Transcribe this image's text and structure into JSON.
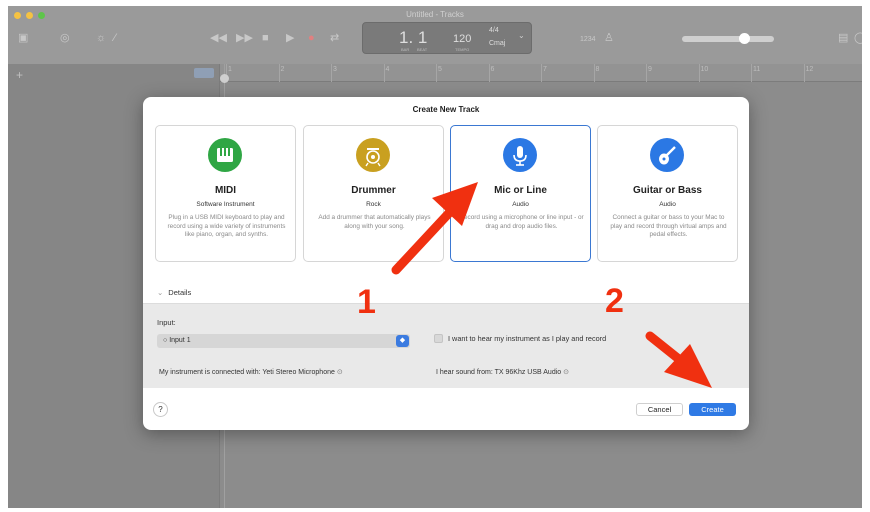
{
  "window": {
    "title": "Untitled - Tracks",
    "traffic_colors": [
      "#f5c242",
      "#f5c242",
      "#5ec54a"
    ]
  },
  "lcd": {
    "position": "1. 1",
    "position_sub_bar": "BAR",
    "position_sub_beat": "BEAT",
    "tempo": "120",
    "tempo_sub": "TEMPO",
    "time_signature": "4/4",
    "key": "Cmaj"
  },
  "toolbar": {
    "count_in": "1234"
  },
  "ruler": {
    "bars": [
      "1",
      "2",
      "3",
      "4",
      "5",
      "6",
      "7",
      "8",
      "9",
      "10",
      "11",
      "12"
    ]
  },
  "dialog": {
    "title": "Create New Track",
    "cards": [
      {
        "name": "MIDI",
        "sub": "Software Instrument",
        "desc": "Plug in a USB MIDI keyboard to play and record using a wide variety of instruments like piano, organ, and synths.",
        "icon": "piano-keys-icon",
        "color": "#2fa644"
      },
      {
        "name": "Drummer",
        "sub": "Rock",
        "desc": "Add a drummer that automatically plays along with your song.",
        "icon": "drum-kit-icon",
        "color": "#c9a020"
      },
      {
        "name": "Mic or Line",
        "sub": "Audio",
        "desc": "Record using a microphone or line input - or drag and drop audio files.",
        "icon": "microphone-icon",
        "color": "#2b78e4"
      },
      {
        "name": "Guitar or Bass",
        "sub": "Audio",
        "desc": "Connect a guitar or bass to your Mac to play and record through virtual amps and pedal effects.",
        "icon": "guitar-icon",
        "color": "#2b78e4"
      }
    ],
    "details_label": "Details",
    "input_label": "Input:",
    "input_value": "Input 1",
    "monitor_label": "I want to hear my instrument as I play and record",
    "connected_text": "My instrument is connected with: Yeti Stereo Microphone",
    "hear_text": "I hear sound from: TX 96Khz USB Audio",
    "help_label": "?",
    "cancel_label": "Cancel",
    "create_label": "Create"
  },
  "annotations": {
    "step1": "1",
    "step2": "2",
    "arrow_color": "#f03010"
  }
}
